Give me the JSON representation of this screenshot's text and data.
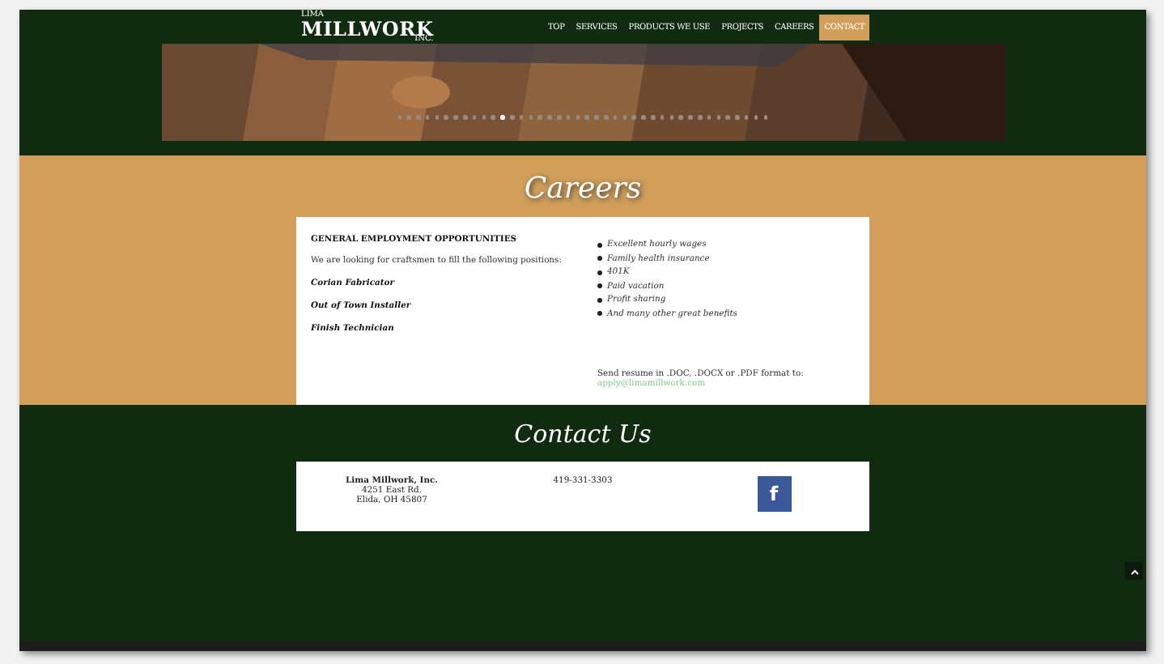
{
  "header": {
    "logo": {
      "small_top": "LIMA",
      "name": "MILLWORK",
      "small_bottom": "INC."
    },
    "nav": [
      {
        "label": "TOP",
        "selected": false
      },
      {
        "label": "SERVICES",
        "selected": false
      },
      {
        "label": "PRODUCTS WE USE",
        "selected": false
      },
      {
        "label": "PROJECTS",
        "selected": false
      },
      {
        "label": "CAREERS",
        "selected": false
      },
      {
        "label": "CONTACT",
        "selected": true
      }
    ]
  },
  "hero": {
    "kind": "picture",
    "dots": [
      {
        "selected": false
      },
      {
        "selected": false
      },
      {
        "selected": false
      },
      {
        "selected": false
      },
      {
        "selected": false
      },
      {
        "selected": false
      },
      {
        "selected": false
      },
      {
        "selected": false
      },
      {
        "selected": false
      },
      {
        "selected": false
      },
      {
        "selected": false
      },
      {
        "selected": true
      },
      {
        "selected": false
      },
      {
        "selected": false
      },
      {
        "selected": false
      },
      {
        "selected": false
      },
      {
        "selected": false
      },
      {
        "selected": false
      },
      {
        "selected": false
      },
      {
        "selected": false
      },
      {
        "selected": false
      },
      {
        "selected": false
      },
      {
        "selected": false
      },
      {
        "selected": false
      },
      {
        "selected": false
      },
      {
        "selected": false
      },
      {
        "selected": false
      },
      {
        "selected": false
      },
      {
        "selected": false
      },
      {
        "selected": false
      },
      {
        "selected": false
      },
      {
        "selected": false
      },
      {
        "selected": false
      },
      {
        "selected": false
      },
      {
        "selected": false
      },
      {
        "selected": false
      },
      {
        "selected": false
      },
      {
        "selected": false
      },
      {
        "selected": false
      },
      {
        "selected": false
      }
    ]
  },
  "careers": {
    "title": "Careers",
    "heading": "GENERAL EMPLOYMENT OPPORTUNITIES",
    "intro": "We are looking for craftsmen to fill the following positions:",
    "positions": [
      "Corian Fabricator",
      "Out of Town Installer",
      "Finish Technician"
    ],
    "benefits": [
      "Excellent hourly wages",
      "Family health insurance",
      "401K",
      "Paid vacation",
      "Profit sharing",
      "And many other great benefits"
    ],
    "resume_note": "Send resume in .DOC, .DOCX or .PDF format to:",
    "email": "apply@limamillwork.com"
  },
  "contact": {
    "title": "Contact Us",
    "company": "Lima Millwork, Inc.",
    "address": [
      "4251 East Rd.",
      "Elida, OH 45807"
    ],
    "phone": "419-331-3303",
    "social": "f"
  }
}
